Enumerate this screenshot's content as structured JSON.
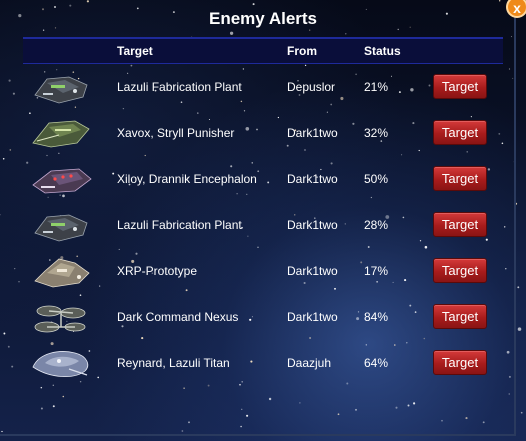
{
  "dialog": {
    "title": "Enemy Alerts",
    "close_label": "x"
  },
  "table": {
    "headers": {
      "target": "Target",
      "from": "From",
      "status": "Status"
    },
    "rows": [
      {
        "target": "Lazuli Fabrication Plant",
        "from": "Depuslor",
        "status": "21%",
        "action": "Target",
        "ship_icon": "fabrication-plant-ship-icon"
      },
      {
        "target": "Xavox, Stryll Punisher",
        "from": "Dark1two",
        "status": "32%",
        "action": "Target",
        "ship_icon": "punisher-ship-icon"
      },
      {
        "target": "Xiloy, Drannik Encephalon",
        "from": "Dark1two",
        "status": "50%",
        "action": "Target",
        "ship_icon": "encephalon-ship-icon"
      },
      {
        "target": "Lazuli Fabrication Plant",
        "from": "Dark1two",
        "status": "28%",
        "action": "Target",
        "ship_icon": "fabrication-plant-ship-icon"
      },
      {
        "target": "XRP-Prototype",
        "from": "Dark1two",
        "status": "17%",
        "action": "Target",
        "ship_icon": "prototype-ship-icon"
      },
      {
        "target": "Dark Command Nexus",
        "from": "Dark1two",
        "status": "84%",
        "action": "Target",
        "ship_icon": "nexus-ship-icon"
      },
      {
        "target": "Reynard, Lazuli Titan",
        "from": "Daazjuh",
        "status": "64%",
        "action": "Target",
        "ship_icon": "titan-ship-icon"
      }
    ]
  },
  "colors": {
    "button": "#b82424",
    "header_bar": "#0a0e3a",
    "header_border": "#1e2a9a",
    "close_button": "#ef8a1a"
  }
}
